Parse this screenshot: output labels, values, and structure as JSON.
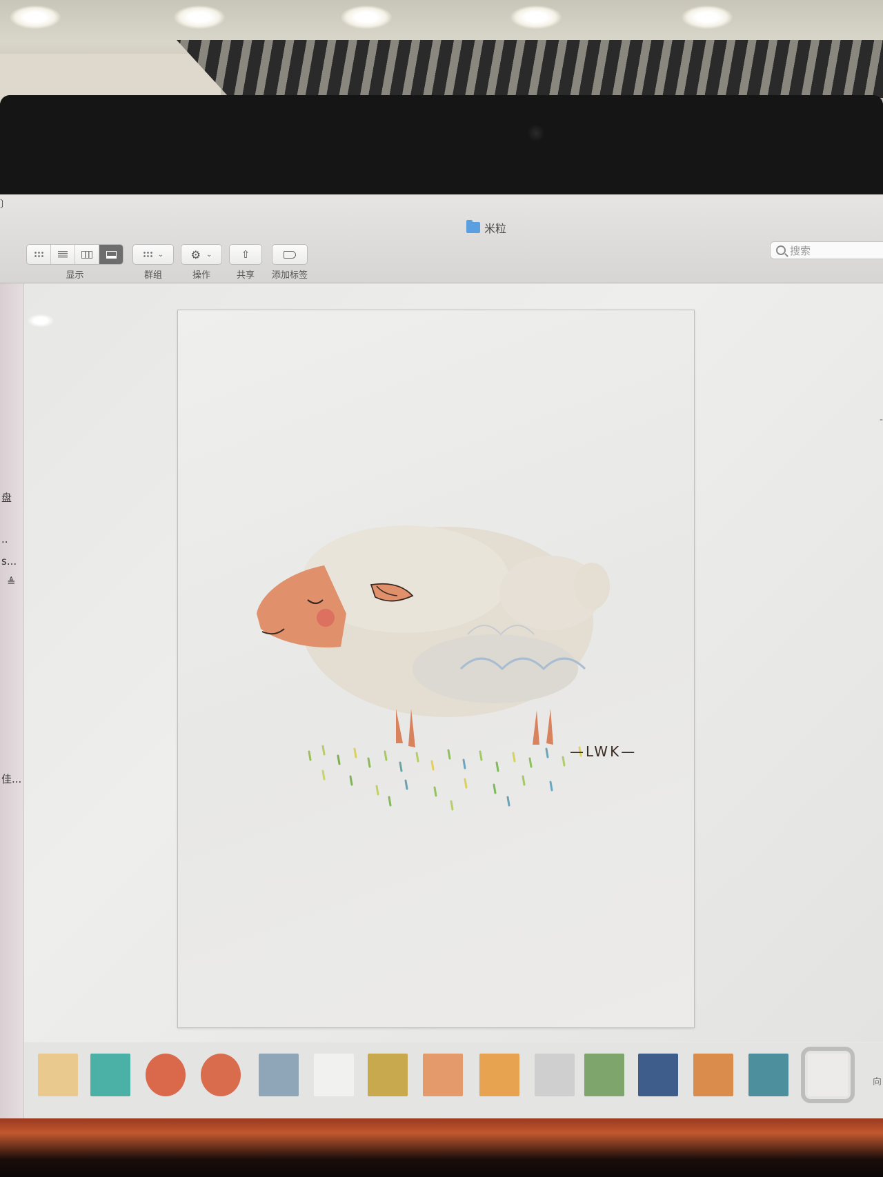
{
  "window": {
    "title": "米粒",
    "folder_icon": "folder-icon"
  },
  "toolbar": {
    "view": {
      "label": "显示",
      "buttons": [
        "icon-view",
        "list-view",
        "column-view",
        "cover-flow-view"
      ],
      "active": "cover-flow-view"
    },
    "group": {
      "label": "群组"
    },
    "action": {
      "label": "操作"
    },
    "share": {
      "label": "共享"
    },
    "tag": {
      "label": "添加标签"
    }
  },
  "search": {
    "placeholder": "搜索"
  },
  "sidebar": {
    "fragments": [
      "盘",
      "..",
      "s...",
      "≜",
      "佳..."
    ]
  },
  "preview": {
    "signature": "—LWK—",
    "subject": "sheep illustration"
  },
  "filmstrip": {
    "thumbnails": [
      {
        "name": "thumb-1",
        "color": "#e9c98d"
      },
      {
        "name": "thumb-frog",
        "color": "#4bb0a6"
      },
      {
        "name": "thumb-circle-1",
        "color": "#d9694a"
      },
      {
        "name": "thumb-circle-2",
        "color": "#d86c4c"
      },
      {
        "name": "thumb-5",
        "color": "#8fa6b8"
      },
      {
        "name": "thumb-6",
        "color": "#f1f1f0"
      },
      {
        "name": "thumb-bus",
        "color": "#c9a94e"
      },
      {
        "name": "thumb-8",
        "color": "#e49a6b"
      },
      {
        "name": "thumb-poster",
        "color": "#e7a34f"
      },
      {
        "name": "thumb-sketch",
        "color": "#cfcfcf"
      },
      {
        "name": "thumb-scene",
        "color": "#7ea56b"
      },
      {
        "name": "thumb-owl",
        "color": "#3e5d8a"
      },
      {
        "name": "thumb-fox",
        "color": "#d98c4c"
      },
      {
        "name": "thumb-bird",
        "color": "#4d8f9d"
      },
      {
        "name": "thumb-sheep",
        "color": "#ecebea",
        "selected": true
      }
    ],
    "trailing": "向"
  }
}
